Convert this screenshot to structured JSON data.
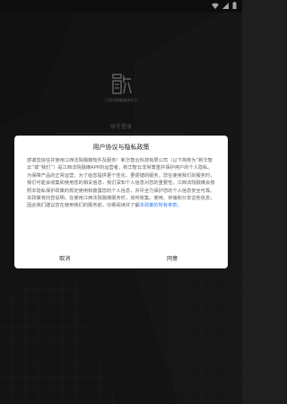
{
  "status_bar": {
    "icons": [
      "wifi-icon",
      "signal-icon",
      "battery-icon"
    ]
  },
  "logo": {
    "subtitle": "江西法院融媒体中心"
  },
  "login": {
    "label": "账号登录"
  },
  "dialog": {
    "title": "用户协议与隐私政策",
    "body_text": "感谢您信任并使用江西法院融媒软件及服务！新华智云科技有限公司（以下简称为“新华智云”或“我们”）是江西法院融媒APP的运营者，新华智云非常尊重并保护用户的个人隐私。为保障产品的正常运营，为了给您提供更个性化、更便捷的服务。您在使用我们的服务时，我们可能会收集和使用您的相关信息，我们深知个人信息对您的重要性，江西法院融媒会按照本隐私保护政策的规定使用和披露您的个人信息，并尽全力保护您的个人信息安全可靠。本政策将向您说明，在使用江西法院融媒服务时，如何收集、使用、存储和分享这些信息，因此我们建议您在使用我们的服务前，仔细阅读并了解本政策的所有条款。",
    "link_text": "本政策的所有条款。",
    "cancel_label": "取消",
    "agree_label": "同意"
  },
  "colors": {
    "link": "#2e7cf6",
    "background": "#1e1e1e"
  }
}
